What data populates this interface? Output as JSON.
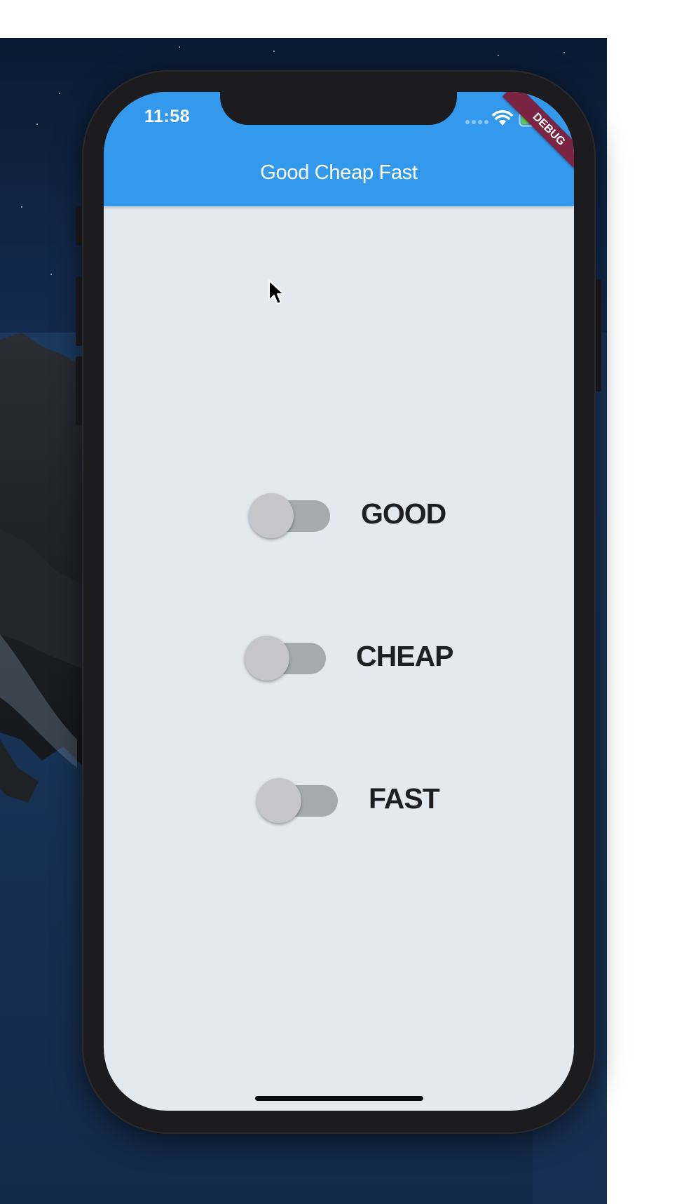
{
  "status_bar": {
    "time": "11:58",
    "icons": [
      "signal-dots-icon",
      "wifi-icon",
      "battery-charging-icon"
    ]
  },
  "app_bar": {
    "title": "Good Cheap Fast",
    "color": "#3399ec"
  },
  "debug_banner": {
    "label": "DEBUG",
    "color": "#7a2441"
  },
  "toggles": [
    {
      "label": "GOOD",
      "on": false
    },
    {
      "label": "CHEAP",
      "on": false
    },
    {
      "label": "FAST",
      "on": false
    }
  ],
  "colors": {
    "background": "#e4e9ef",
    "switch_track_off": "#a7aaad",
    "switch_thumb_off": "#c6c6ca",
    "label_text": "#1e1f22"
  }
}
